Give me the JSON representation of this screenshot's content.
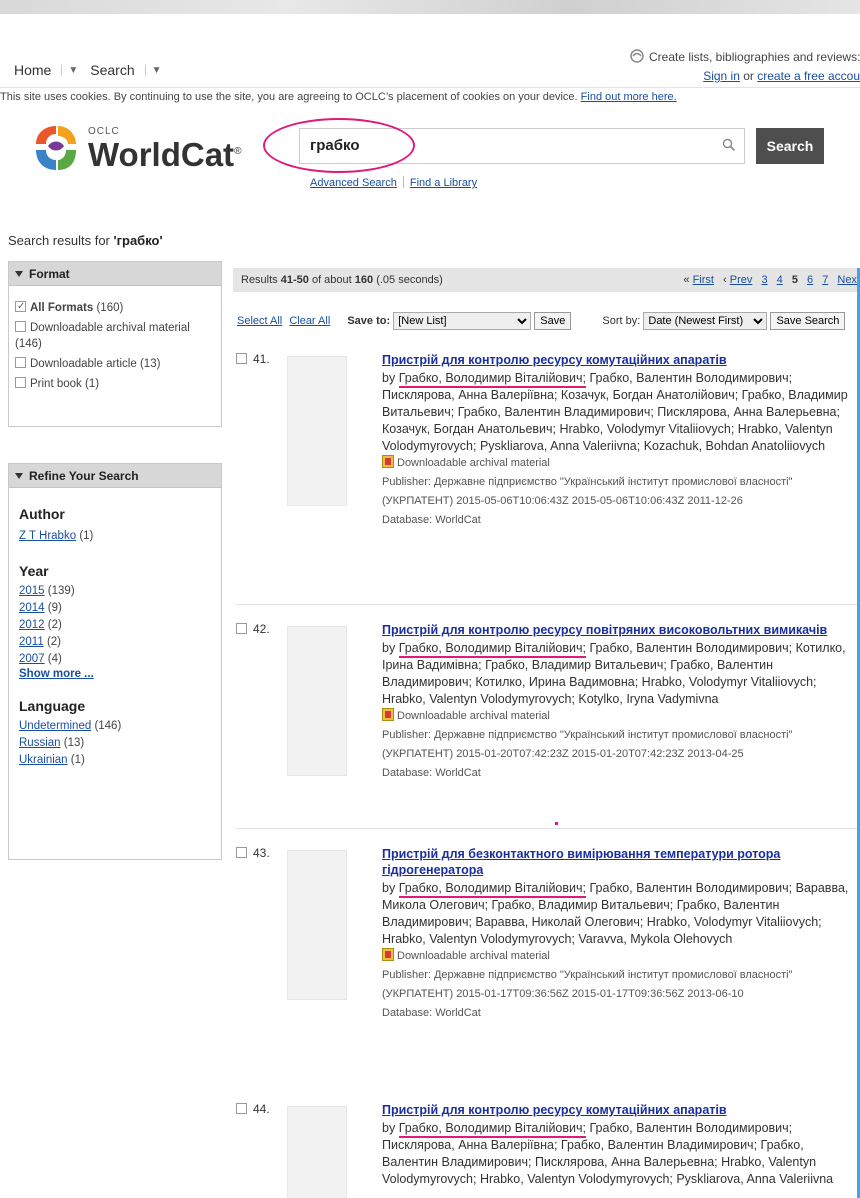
{
  "nav": {
    "home": "Home",
    "search": "Search",
    "promo_line1": "Create lists, bibliographies and reviews:",
    "sign_in": "Sign in",
    "or": "or",
    "create_account": "create a free accou"
  },
  "cookie": {
    "text": "This site uses cookies. By continuing to use the site, you are agreeing to OCLC’s placement of cookies on your device.",
    "link": "Find out more here."
  },
  "brand": {
    "oclc": "OCLC",
    "name": "WorldCat",
    "reg": "®"
  },
  "search": {
    "query": "грабко",
    "button": "Search",
    "advanced": "Advanced Search",
    "find_library": "Find a Library"
  },
  "results_for": {
    "label": "Search results for",
    "query": "'грабко'"
  },
  "format_panel": {
    "title": "Format",
    "items": [
      {
        "label": "All Formats",
        "count": "(160)",
        "checked": true
      },
      {
        "label": "Downloadable archival material",
        "count": "(146)",
        "checked": false
      },
      {
        "label": "Downloadable article",
        "count": "(13)",
        "checked": false
      },
      {
        "label": "Print book",
        "count": "(1)",
        "checked": false
      }
    ]
  },
  "refine_panel": {
    "title": "Refine Your Search",
    "author_title": "Author",
    "authors": [
      {
        "label": "Z T Hrabko",
        "count": "(1)"
      }
    ],
    "year_title": "Year",
    "years": [
      {
        "label": "2015",
        "count": "(139)"
      },
      {
        "label": "2014",
        "count": "(9)"
      },
      {
        "label": "2012",
        "count": "(2)"
      },
      {
        "label": "2011",
        "count": "(2)"
      },
      {
        "label": "2007",
        "count": "(4)"
      }
    ],
    "show_more": "Show more ...",
    "language_title": "Language",
    "languages": [
      {
        "label": "Undetermined",
        "count": "(146)"
      },
      {
        "label": "Russian",
        "count": "(13)"
      },
      {
        "label": "Ukrainian",
        "count": "(1)"
      }
    ]
  },
  "results_header": {
    "prefix": "Results",
    "range": "41-50",
    "of_about": "of about",
    "total": "160",
    "time": "(.05 seconds)",
    "first": "First",
    "prev": "Prev",
    "pages": [
      "3",
      "4",
      "5",
      "6",
      "7"
    ],
    "current_page": "5",
    "next": "Next"
  },
  "actions": {
    "select_all": "Select All",
    "clear_all": "Clear All",
    "save_to": "Save to:",
    "list_option": "[New List]",
    "save": "Save",
    "sort_by": "Sort by:",
    "sort_option": "Date (Newest First)",
    "save_search": "Save Search"
  },
  "results": [
    {
      "num": "41.",
      "title": "Пристрій для контролю ресурсу комутаційних апаратів",
      "by": "by",
      "author_hl": "Грабко, Володимир Віталійович;",
      "authors_rest": "Грабко, Валентин Володимирович; Писклярова, Анна Валеріївна; Козачук, Богдан Анатолійович; Грабко, Владимир Витальевич; Грабко, Валентин Владимирович; Писклярова, Анна Валерьевна; Козачук, Богдан Анатольевич; Hrabko, Volodymyr Vitaliiovych; Hrabko, Valentyn Volodymyrovych; Pyskliarova, Anna Valeriivna; Kozachuk, Bohdan Anatoliiovych",
      "type": "Downloadable archival material",
      "publisher": "Publisher: Державне підприємство \"Український інститут промислової власності\" (УКРПАТЕНТ) 2015-05-06T10:06:43Z 2015-05-06T10:06:43Z 2011-12-26",
      "database": "Database: WorldCat"
    },
    {
      "num": "42.",
      "title": "Пристрій для контролю ресурсу повітряних високовольтних вимикачів",
      "by": "by",
      "author_hl": "Грабко, Володимир Віталійович;",
      "authors_rest": "Грабко, Валентин Володимирович; Котилко, Ірина Вадимівна; Грабко, Владимир Витальевич; Грабко, Валентин Владимирович; Котилко, Ирина Вадимовна; Hrabko, Volodymyr Vitaliiovych; Hrabko, Valentyn Volodymyrovych; Kotylko, Iryna Vadymivna",
      "type": "Downloadable archival material",
      "publisher": "Publisher: Державне підприємство \"Український інститут промислової власності\" (УКРПАТЕНТ) 2015-01-20T07:42:23Z 2015-01-20T07:42:23Z 2013-04-25",
      "database": "Database: WorldCat"
    },
    {
      "num": "43.",
      "title": "Пристрій для безконтактного вимірювання температури ротора гідрогенератора",
      "by": "by",
      "author_hl": "Грабко, Володимир Віталійович;",
      "authors_rest": "Грабко, Валентин Володимирович; Варавва, Микола Олегович; Грабко, Владимир Витальевич; Грабко, Валентин Владимирович; Варавва, Николай Олегович; Hrabko, Volodymyr Vitaliiovych; Hrabko, Valentyn Volodymyrovych; Varavva, Mykola Olehovych",
      "type": "Downloadable archival material",
      "publisher": "Publisher: Державне підприємство \"Український інститут промислової власності\" (УКРПАТЕНТ) 2015-01-17T09:36:56Z 2015-01-17T09:36:56Z 2013-06-10",
      "database": "Database: WorldCat"
    },
    {
      "num": "44.",
      "title": "Пристрій для контролю ресурсу комутаційних апаратів",
      "by": "by",
      "author_hl": "Грабко, Володимир Віталійович;",
      "authors_rest": "Грабко, Валентин Володимирович; Писклярова, Анна Валеріївна; Грабко, Валентин Владимирович; Грабко, Валентин Владимирович; Писклярова, Анна Валерьевна; Hrabko, Valentyn Volodymyrovych; Hrabko, Valentyn Volodymyrovych; Pyskliarova, Anna Valeriivna",
      "type": "",
      "publisher": "",
      "database": ""
    }
  ]
}
